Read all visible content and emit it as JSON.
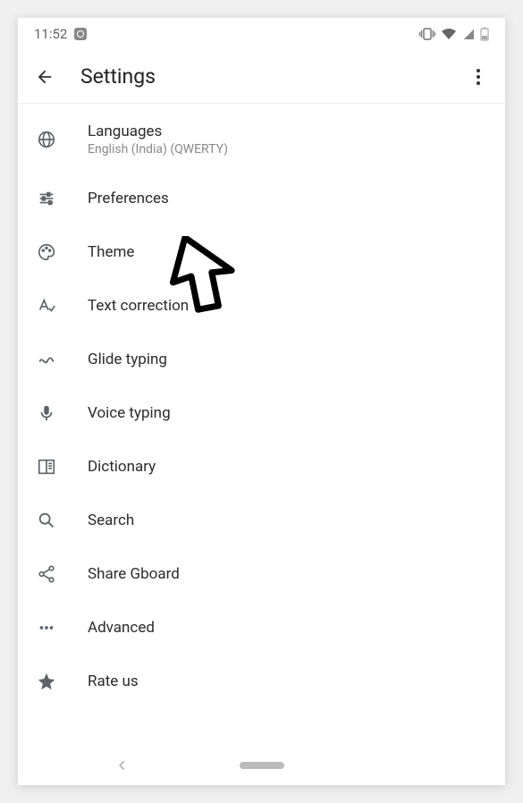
{
  "status": {
    "time": "11:52"
  },
  "header": {
    "title": "Settings"
  },
  "items": [
    {
      "icon": "globe-icon",
      "label": "Languages",
      "sub": "English (India) (QWERTY)"
    },
    {
      "icon": "sliders-icon",
      "label": "Preferences",
      "sub": ""
    },
    {
      "icon": "palette-icon",
      "label": "Theme",
      "sub": ""
    },
    {
      "icon": "text-icon",
      "label": "Text correction",
      "sub": ""
    },
    {
      "icon": "squiggle-icon",
      "label": "Glide typing",
      "sub": ""
    },
    {
      "icon": "mic-icon",
      "label": "Voice typing",
      "sub": ""
    },
    {
      "icon": "book-icon",
      "label": "Dictionary",
      "sub": ""
    },
    {
      "icon": "search-icon",
      "label": "Search",
      "sub": ""
    },
    {
      "icon": "share-icon",
      "label": "Share Gboard",
      "sub": ""
    },
    {
      "icon": "dots-icon",
      "label": "Advanced",
      "sub": ""
    },
    {
      "icon": "star-icon",
      "label": "Rate us",
      "sub": ""
    }
  ]
}
